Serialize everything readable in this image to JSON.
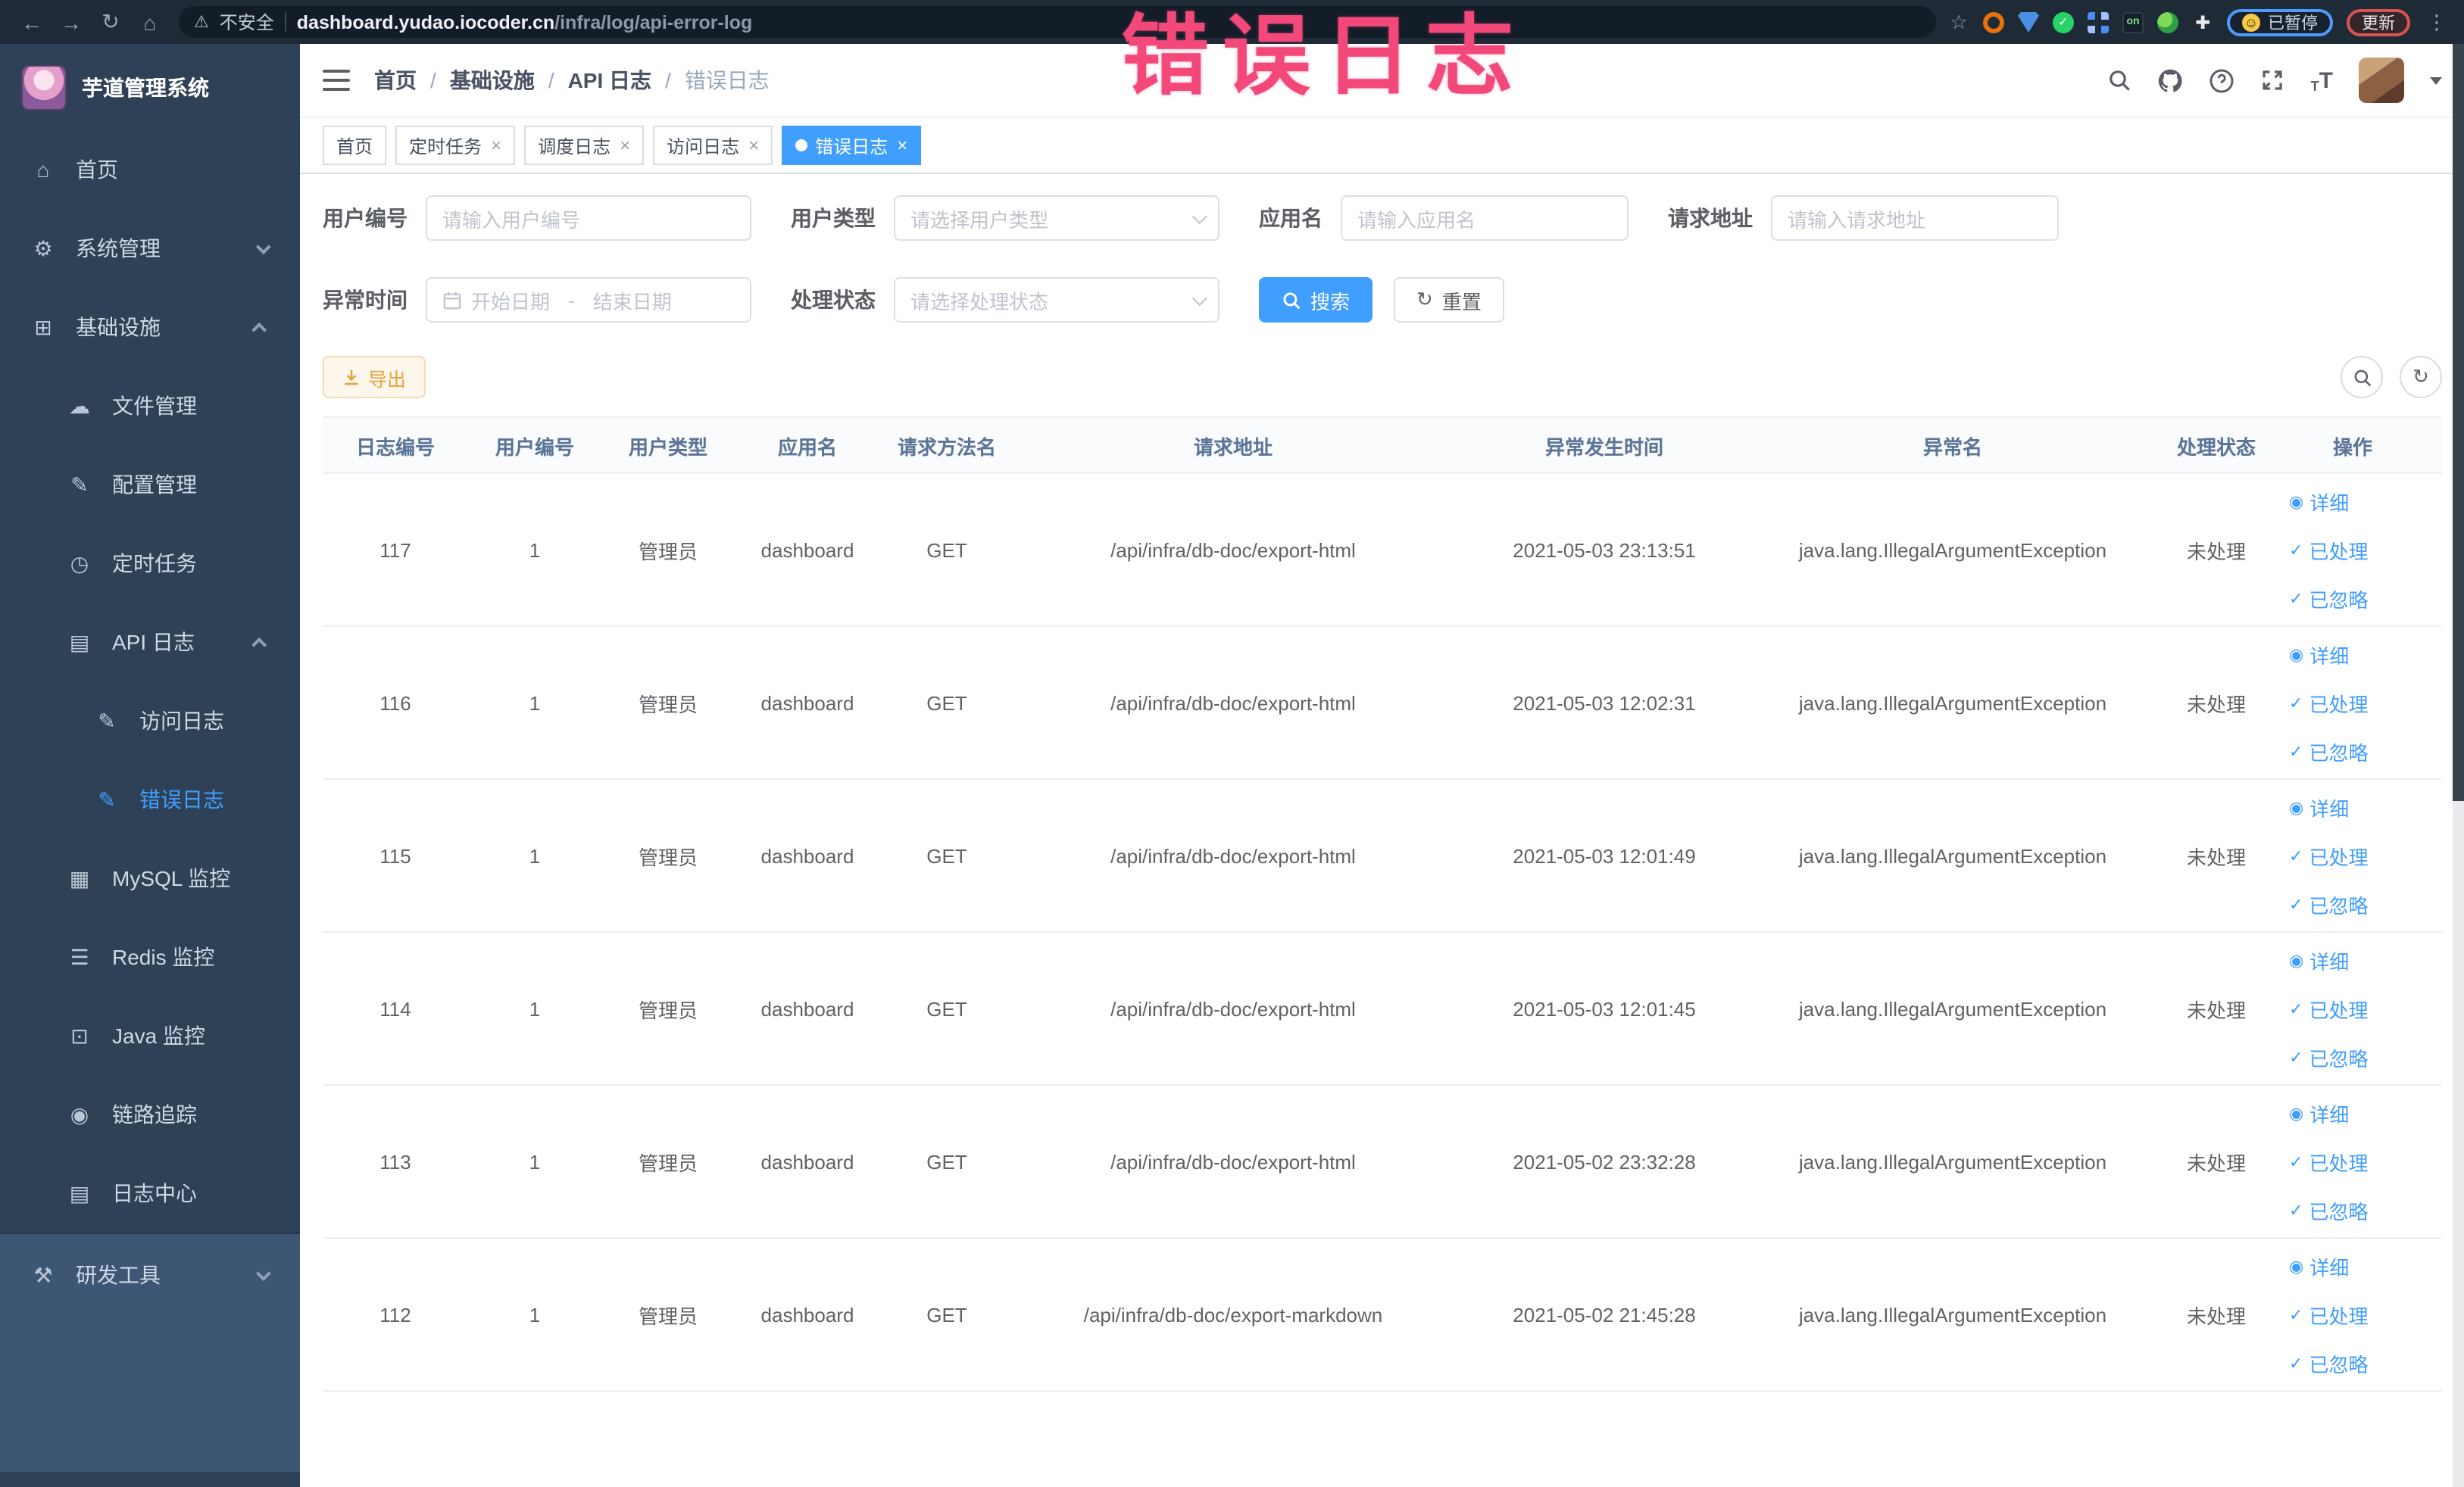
{
  "colors": {
    "primary": "#409eff",
    "warning": "#e6a23c",
    "sidebar_bg": "#2e4156",
    "annotation_pink": "#f3497a"
  },
  "annotation": {
    "text": "错误日志"
  },
  "browser": {
    "security_label": "不安全",
    "url_domain": "dashboard.yudao.iocoder.cn",
    "url_path": "/infra/log/api-error-log",
    "paused_badge_label": "已暂停",
    "update_button_label": "更新"
  },
  "sidebar": {
    "title": "芋道管理系统",
    "items": [
      {
        "label": "首页",
        "glyph": "⌂"
      },
      {
        "label": "系统管理",
        "glyph": "⚙"
      },
      {
        "label": "基础设施",
        "glyph": "⊞"
      },
      {
        "label": "文件管理",
        "glyph": "☁"
      },
      {
        "label": "配置管理",
        "glyph": "✎"
      },
      {
        "label": "定时任务",
        "glyph": "◷"
      },
      {
        "label": "API 日志",
        "glyph": "▤"
      },
      {
        "label": "访问日志",
        "glyph": "✎"
      },
      {
        "label": "错误日志",
        "glyph": "✎"
      },
      {
        "label": "MySQL 监控",
        "glyph": "▦"
      },
      {
        "label": "Redis 监控",
        "glyph": "☰"
      },
      {
        "label": "Java 监控",
        "glyph": "⊡"
      },
      {
        "label": "链路追踪",
        "glyph": "◉"
      },
      {
        "label": "日志中心",
        "glyph": "▤"
      },
      {
        "label": "研发工具",
        "glyph": "⚒"
      }
    ]
  },
  "navbar": {
    "breadcrumb": [
      "首页",
      "基础设施",
      "API 日志",
      "错误日志"
    ],
    "separator": "/"
  },
  "tabs": [
    {
      "label": "首页",
      "closable": false,
      "active": false
    },
    {
      "label": "定时任务",
      "closable": true,
      "active": false
    },
    {
      "label": "调度日志",
      "closable": true,
      "active": false
    },
    {
      "label": "访问日志",
      "closable": true,
      "active": false
    },
    {
      "label": "错误日志",
      "closable": true,
      "active": true
    }
  ],
  "filter": {
    "user_id": {
      "label": "用户编号",
      "placeholder": "请输入用户编号"
    },
    "user_type": {
      "label": "用户类型",
      "placeholder": "请选择用户类型"
    },
    "app_name": {
      "label": "应用名",
      "placeholder": "请输入应用名"
    },
    "request_url": {
      "label": "请求地址",
      "placeholder": "请输入请求地址"
    },
    "exception_time": {
      "label": "异常时间",
      "start_placeholder": "开始日期",
      "range_separator": "-",
      "end_placeholder": "结束日期"
    },
    "process_status": {
      "label": "处理状态",
      "placeholder": "请选择处理状态"
    },
    "search_button": "搜索",
    "reset_button": "重置"
  },
  "toolbar": {
    "export_button": "导出"
  },
  "table": {
    "columns": [
      {
        "key": "id",
        "label": "日志编号"
      },
      {
        "key": "user_id",
        "label": "用户编号"
      },
      {
        "key": "user_type",
        "label": "用户类型"
      },
      {
        "key": "app",
        "label": "应用名"
      },
      {
        "key": "method",
        "label": "请求方法名"
      },
      {
        "key": "url",
        "label": "请求地址"
      },
      {
        "key": "time",
        "label": "异常发生时间"
      },
      {
        "key": "exception",
        "label": "异常名"
      },
      {
        "key": "status",
        "label": "处理状态"
      },
      {
        "key": "actions",
        "label": "操作"
      }
    ],
    "row_actions": [
      {
        "name": "detail-link",
        "icon_name": "eye-icon",
        "glyph": "◉",
        "label": "详细"
      },
      {
        "name": "processed-link",
        "icon_name": "check-icon",
        "glyph": "✓",
        "label": "已处理"
      },
      {
        "name": "ignored-link",
        "icon_name": "check-icon",
        "glyph": "✓",
        "label": "已忽略"
      }
    ],
    "rows": [
      {
        "id": "117",
        "user_id": "1",
        "user_type": "管理员",
        "app": "dashboard",
        "method": "GET",
        "url": "/api/infra/db-doc/export-html",
        "time": "2021-05-03 23:13:51",
        "exception": "java.lang.IllegalArgumentException",
        "status": "未处理"
      },
      {
        "id": "116",
        "user_id": "1",
        "user_type": "管理员",
        "app": "dashboard",
        "method": "GET",
        "url": "/api/infra/db-doc/export-html",
        "time": "2021-05-03 12:02:31",
        "exception": "java.lang.IllegalArgumentException",
        "status": "未处理"
      },
      {
        "id": "115",
        "user_id": "1",
        "user_type": "管理员",
        "app": "dashboard",
        "method": "GET",
        "url": "/api/infra/db-doc/export-html",
        "time": "2021-05-03 12:01:49",
        "exception": "java.lang.IllegalArgumentException",
        "status": "未处理"
      },
      {
        "id": "114",
        "user_id": "1",
        "user_type": "管理员",
        "app": "dashboard",
        "method": "GET",
        "url": "/api/infra/db-doc/export-html",
        "time": "2021-05-03 12:01:45",
        "exception": "java.lang.IllegalArgumentException",
        "status": "未处理"
      },
      {
        "id": "113",
        "user_id": "1",
        "user_type": "管理员",
        "app": "dashboard",
        "method": "GET",
        "url": "/api/infra/db-doc/export-html",
        "time": "2021-05-02 23:32:28",
        "exception": "java.lang.IllegalArgumentException",
        "status": "未处理"
      },
      {
        "id": "112",
        "user_id": "1",
        "user_type": "管理员",
        "app": "dashboard",
        "method": "GET",
        "url": "/api/infra/db-doc/export-markdown",
        "time": "2021-05-02 21:45:28",
        "exception": "java.lang.IllegalArgumentException",
        "status": "未处理"
      }
    ]
  }
}
